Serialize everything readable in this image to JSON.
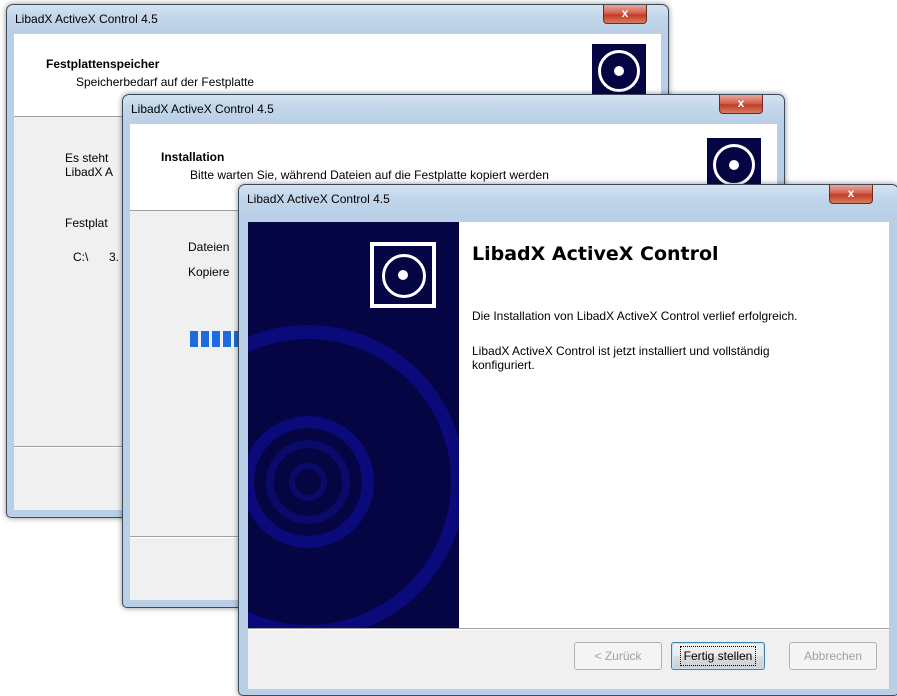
{
  "colors": {
    "window_frame": "#b9cfe6",
    "close_button": "#c13c27",
    "side_panel": "#050544",
    "progress": "#1e6bdf"
  },
  "dialog1": {
    "title": "LibadX ActiveX Control 4.5",
    "close_label": "x",
    "header_title": "Festplattenspeicher",
    "header_subtitle": "Speicherbedarf auf der Festplatte",
    "line1": "Es steht",
    "line2": "LibadX A",
    "line3": "Festplat",
    "drive": "C:\\",
    "drive_value": "3."
  },
  "dialog2": {
    "title": "LibadX ActiveX Control 4.5",
    "close_label": "x",
    "header_title": "Installation",
    "header_subtitle": "Bitte warten Sie, während Dateien auf die Festplatte kopiert werden",
    "line1": "Dateien",
    "line2": "Kopiere",
    "progress_icon": "progress-bar"
  },
  "dialog3": {
    "title": "LibadX ActiveX Control 4.5",
    "close_label": "x",
    "heading": "LibadX ActiveX Control",
    "message1": "Die Installation von LibadX ActiveX Control verlief erfolgreich.",
    "message2_line1": "LibadX ActiveX Control ist jetzt installiert und vollständig",
    "message2_line2": "konfiguriert.",
    "buttons": {
      "back": "< Zurück",
      "finish": "Fertig stellen",
      "cancel": "Abbrechen"
    }
  }
}
